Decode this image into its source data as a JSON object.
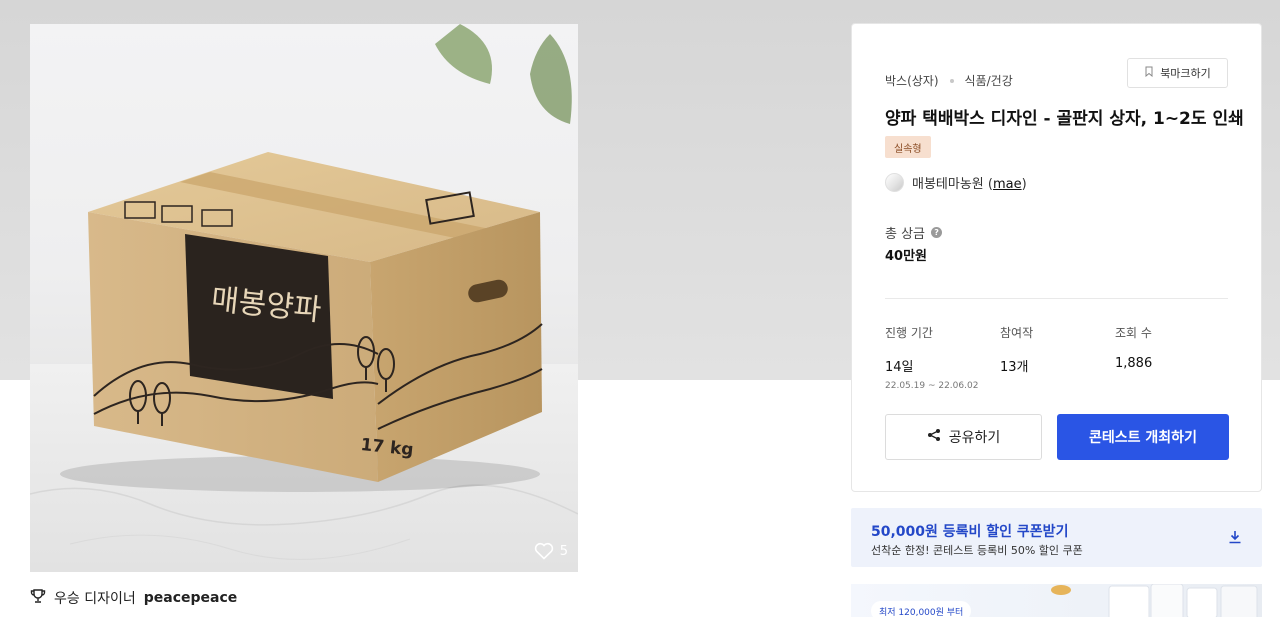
{
  "hero": {
    "box_brand": "매봉양파",
    "box_weight": "17 kg",
    "like_count": "5"
  },
  "winner": {
    "label": "우승 디자이너",
    "name": "peacepeace"
  },
  "contest": {
    "category": "박스(상자)",
    "subcategory": "식품/건강",
    "bookmark_label": "북마크하기",
    "title": "양파 택배박스 디자인 - 골판지 상자, 1~2도 인쇄",
    "tag": "실속형",
    "client_name": "매봉테마농원",
    "client_id": "mae",
    "prize_label": "총 상금",
    "prize_value": "40만원",
    "stats": {
      "period_label": "진행 기간",
      "period_value": "14일",
      "period_dates": "22.05.19 ~ 22.06.02",
      "participants_label": "참여작",
      "participants_value": "13개",
      "views_label": "조회 수",
      "views_value": "1,886"
    },
    "share_label": "공유하기",
    "host_label": "콘테스트 개최하기"
  },
  "coupon": {
    "title": "50,000원 등록비 할인 쿠폰받기",
    "subtitle": "선착순 한정! 콘테스트 등록비 50% 할인 쿠폰"
  },
  "promo": {
    "badge": "최저 120,000원 부터"
  },
  "colors": {
    "primary": "#2a55e5",
    "coupon_text": "#2448c8",
    "tag_bg": "#f7dfcf"
  }
}
